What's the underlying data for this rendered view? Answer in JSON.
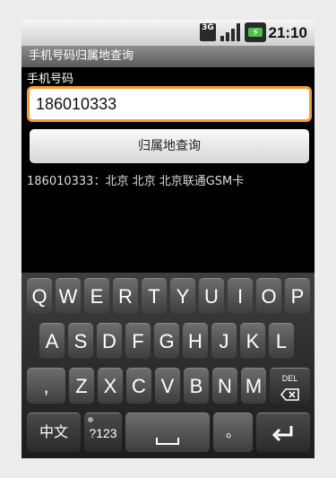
{
  "status": {
    "network": "3G",
    "time": "21:10"
  },
  "app": {
    "title": "手机号码归属地查询"
  },
  "form": {
    "label": "手机号码",
    "phone_value": "186010333",
    "query_button": "归属地查询",
    "result": "186010333：北京 北京 北京联通GSM卡"
  },
  "keyboard": {
    "row1": [
      "Q",
      "W",
      "E",
      "R",
      "T",
      "Y",
      "U",
      "I",
      "O",
      "P"
    ],
    "row2": [
      "A",
      "S",
      "D",
      "F",
      "G",
      "H",
      "J",
      "K",
      "L"
    ],
    "row3": [
      ",",
      "Z",
      "X",
      "C",
      "V",
      "B",
      "N",
      "M"
    ],
    "del_label": "DEL",
    "lang_label": "中文",
    "numbers_label": "?123",
    "period_label": "。"
  }
}
